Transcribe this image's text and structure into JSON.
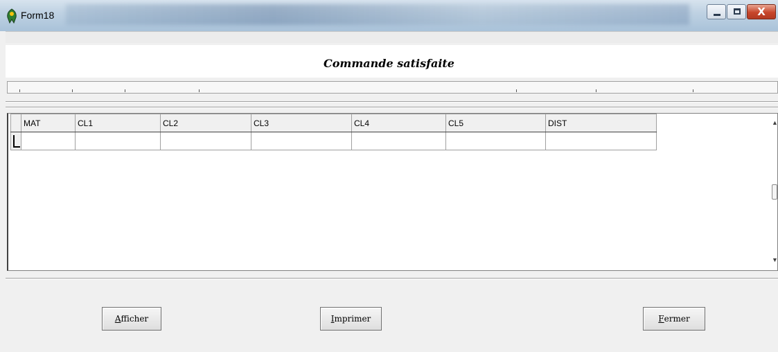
{
  "window": {
    "title": "Form18",
    "icon": "app-icon",
    "close_glyph": "X"
  },
  "header": {
    "title": "Commande satisfaite"
  },
  "grid": {
    "columns": [
      "MAT",
      "CL1",
      "CL2",
      "CL3",
      "CL4",
      "CL5",
      "DIST"
    ],
    "rows": [
      [
        "",
        "",
        "",
        "",
        "",
        "",
        ""
      ]
    ]
  },
  "buttons": {
    "afficher": {
      "first": "A",
      "rest": "fficher"
    },
    "imprimer": {
      "first": "I",
      "rest": "mprimer"
    },
    "fermer": {
      "first": "F",
      "rest": "ermer"
    }
  },
  "scrollbar": {
    "up_arrow": "▲",
    "down_arrow": "▼"
  },
  "colors": {
    "titlebar": "#bfd2e3",
    "close_button": "#c7462b",
    "form_background": "#f0f0f0"
  }
}
